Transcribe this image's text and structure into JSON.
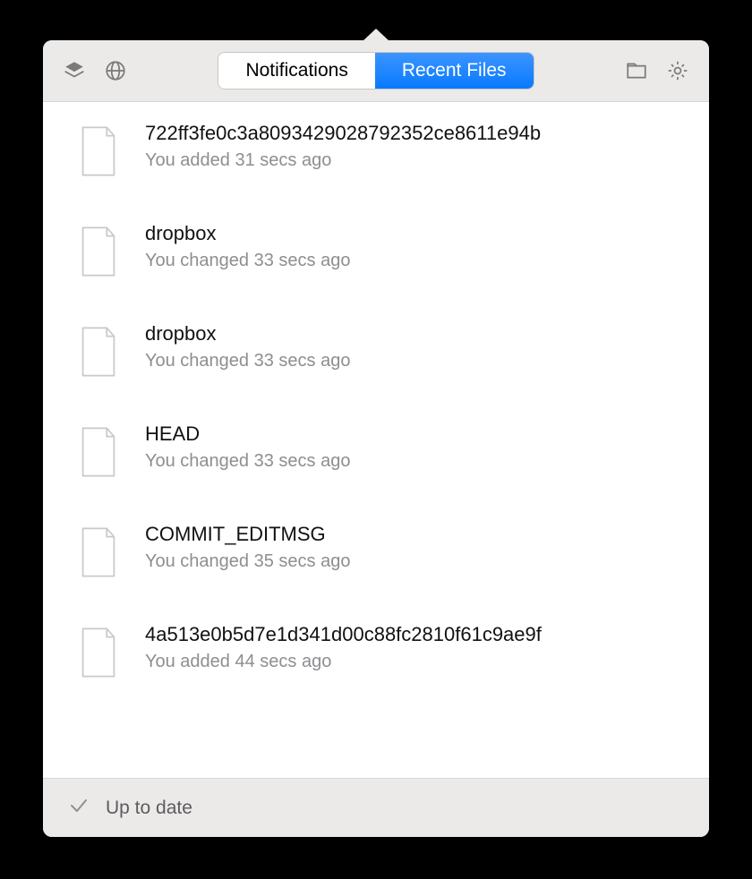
{
  "header": {
    "tabs": {
      "notifications": "Notifications",
      "recent_files": "Recent Files"
    }
  },
  "files": [
    {
      "name": "722ff3fe0c3a8093429028792352ce8611e94b",
      "meta": "You added 31 secs ago"
    },
    {
      "name": "dropbox",
      "meta": "You changed 33 secs ago"
    },
    {
      "name": "dropbox",
      "meta": "You changed 33 secs ago"
    },
    {
      "name": "HEAD",
      "meta": "You changed 33 secs ago"
    },
    {
      "name": "COMMIT_EDITMSG",
      "meta": "You changed 35 secs ago"
    },
    {
      "name": "4a513e0b5d7e1d341d00c88fc2810f61c9ae9f",
      "meta": "You added 44 secs ago"
    }
  ],
  "footer": {
    "status": "Up to date"
  }
}
